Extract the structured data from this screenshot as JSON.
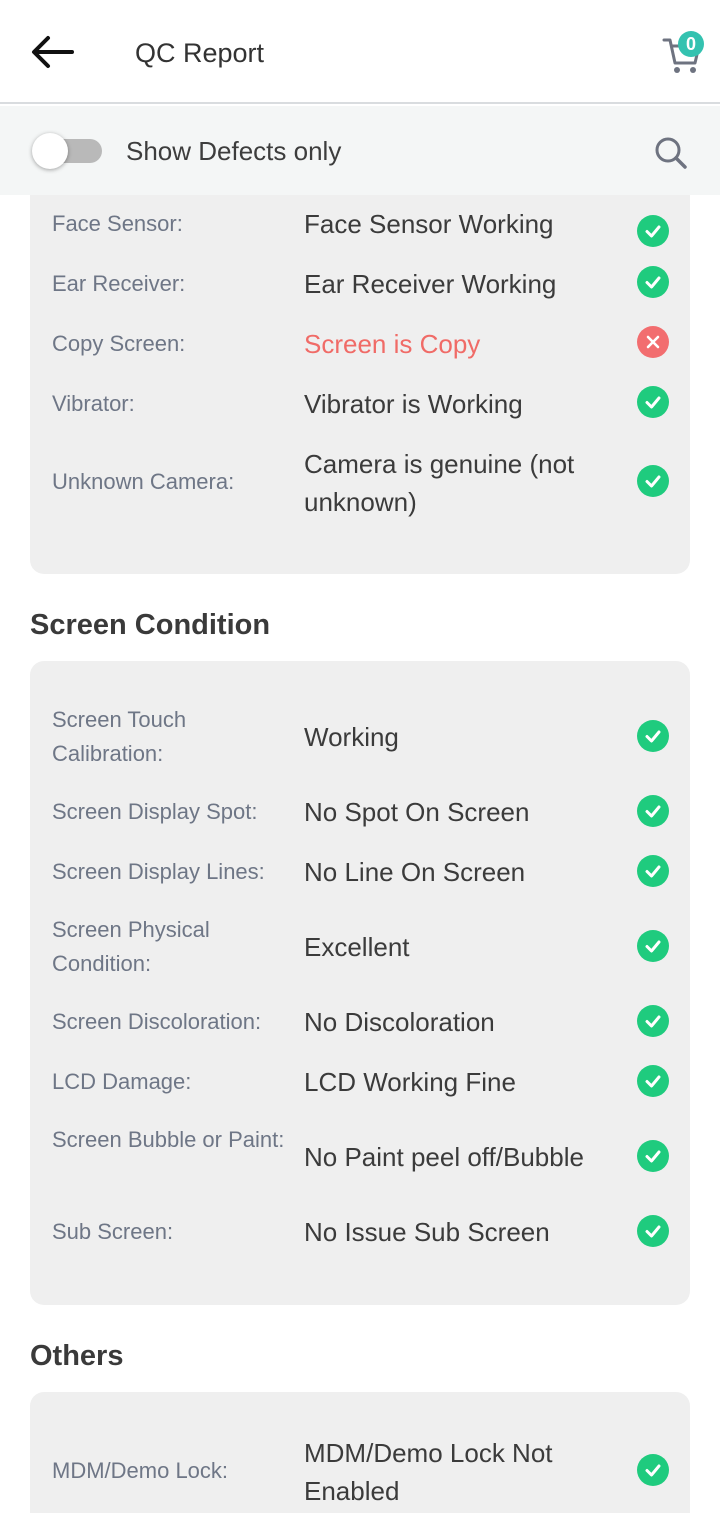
{
  "header": {
    "title": "QC Report",
    "cart_count": "0"
  },
  "filter": {
    "label": "Show Defects only"
  },
  "colors": {
    "ok": "#1fcb7e",
    "defect": "#f26d6f",
    "accent": "#34c2b0"
  },
  "top_card": {
    "rows": [
      {
        "label": "Face Sensor:",
        "value": "Face Sensor Working",
        "status": "ok"
      },
      {
        "label": "Ear Receiver:",
        "value": "Ear Receiver Working",
        "status": "ok"
      },
      {
        "label": "Copy Screen:",
        "value": "Screen is Copy",
        "status": "defect"
      },
      {
        "label": "Vibrator:",
        "value": "Vibrator is Working",
        "status": "ok"
      },
      {
        "label": "Unknown Camera:",
        "value": "Camera is genuine (not unknown)",
        "status": "ok"
      }
    ]
  },
  "screen_condition": {
    "title": "Screen Condition",
    "rows": [
      {
        "label": "Screen Touch Calibration:",
        "value": "Working",
        "status": "ok"
      },
      {
        "label": "Screen Display Spot:",
        "value": "No Spot On Screen",
        "status": "ok"
      },
      {
        "label": "Screen Display Lines:",
        "value": "No Line On Screen",
        "status": "ok"
      },
      {
        "label": "Screen Physical Condition:",
        "value": "Excellent",
        "status": "ok"
      },
      {
        "label": "Screen Discoloration:",
        "value": "No Discoloration",
        "status": "ok"
      },
      {
        "label": "LCD Damage:",
        "value": "LCD Working Fine",
        "status": "ok"
      },
      {
        "label": "Screen Bubble or Paint:",
        "value": "No Paint peel off/Bubble",
        "status": "ok"
      },
      {
        "label": "Sub Screen:",
        "value": "No Issue Sub Screen",
        "status": "ok"
      }
    ]
  },
  "others": {
    "title": "Others",
    "rows": [
      {
        "label": "MDM/Demo Lock:",
        "value": "MDM/Demo Lock Not Enabled",
        "status": "ok"
      }
    ]
  }
}
